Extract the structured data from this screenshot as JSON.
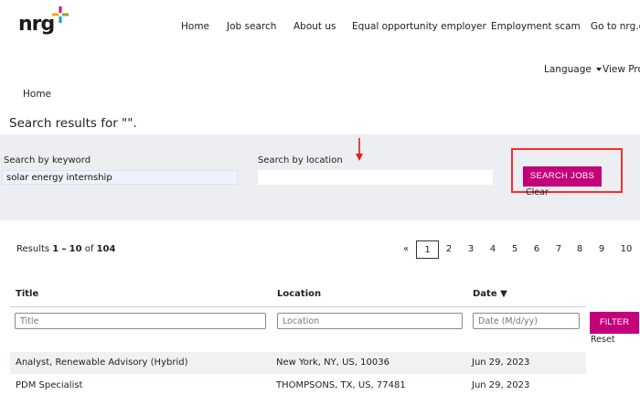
{
  "brand": {
    "logo_text": "nrg",
    "accent": "#c4007a"
  },
  "nav": [
    {
      "label": "Home"
    },
    {
      "label": "Job search"
    },
    {
      "label": "About us"
    },
    {
      "label": "Equal opportunity employer"
    },
    {
      "label": "Employment scam"
    },
    {
      "label": "Go to nrg.c"
    }
  ],
  "utility": {
    "language_label": "Language",
    "view_profile_label": "View Pro"
  },
  "breadcrumb": {
    "label": "Home"
  },
  "results_heading": "Search results for \"\".",
  "search": {
    "keyword_label": "Search by keyword",
    "keyword_value": "solar energy internship",
    "location_label": "Search by location",
    "location_value": "",
    "search_button": "SEARCH JOBS",
    "clear_label": "Clear"
  },
  "results": {
    "prefix": "Results",
    "start": "1",
    "dash": "–",
    "end": "10",
    "of": "of",
    "total": "104"
  },
  "pagination": {
    "prev": "«",
    "pages": [
      "1",
      "2",
      "3",
      "4",
      "5",
      "6",
      "7",
      "8",
      "9",
      "10"
    ],
    "current": "1"
  },
  "table": {
    "headers": {
      "title": "Title",
      "location": "Location",
      "date": "Date ▼"
    },
    "filters": {
      "title_placeholder": "Title",
      "location_placeholder": "Location",
      "date_placeholder": "Date (M/d/yy)"
    },
    "filter_button": "FILTER",
    "reset_label": "Reset",
    "rows": [
      {
        "title": "Analyst, Renewable Advisory (Hybrid)",
        "location": "New York, NY, US, 10036",
        "date": "Jun 29, 2023"
      },
      {
        "title": "PDM Specialist",
        "location": "THOMPSONS, TX, US, 77481",
        "date": "Jun 29, 2023"
      }
    ]
  }
}
